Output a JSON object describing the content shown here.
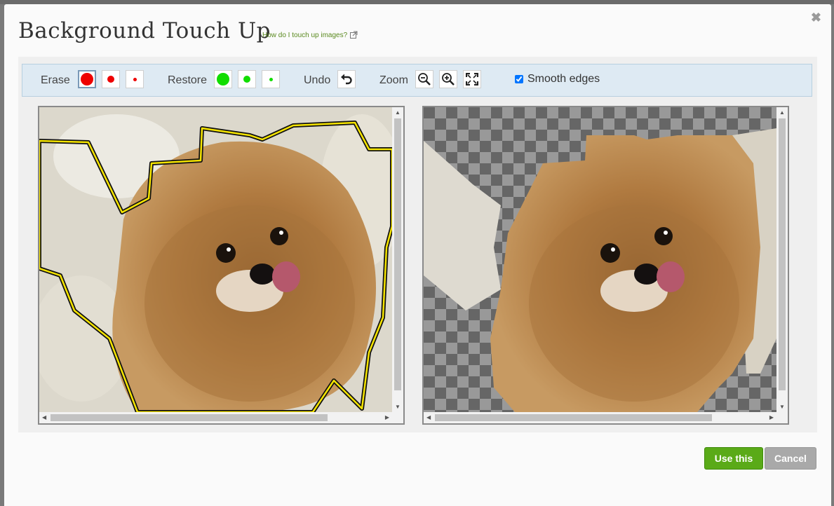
{
  "dialog": {
    "title": "Background Touch Up",
    "help_link": "How do I touch up images?",
    "close_glyph": "✖"
  },
  "toolbar": {
    "erase_label": "Erase",
    "restore_label": "Restore",
    "undo_label": "Undo",
    "zoom_label": "Zoom",
    "smooth_label": "Smooth edges",
    "smooth_checked": true,
    "erase_color": "#ee0000",
    "restore_color": "#11dd00"
  },
  "panes": {
    "left": {
      "name": "original-with-selection",
      "outline_color": "#f5e400"
    },
    "right": {
      "name": "preview-transparent",
      "checker_dark": "#666666",
      "checker_light": "#999999"
    }
  },
  "actions": {
    "use_label": "Use this",
    "cancel_label": "Cancel"
  },
  "colors": {
    "accent_green": "#5aaa18",
    "help_link": "#5a8a1f"
  }
}
